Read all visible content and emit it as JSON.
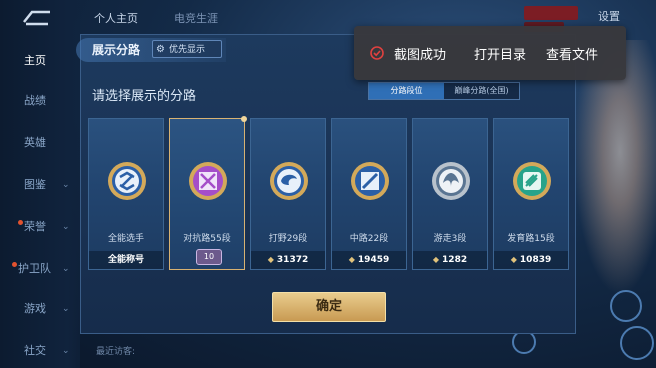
{
  "header": {
    "tab_profile": "个人主页",
    "tab_career": "电竞生涯",
    "settings": "设置"
  },
  "sidebar": {
    "items": [
      {
        "label": "主页",
        "active": true
      },
      {
        "label": "战绩"
      },
      {
        "label": "英雄"
      },
      {
        "label": "图鉴"
      },
      {
        "label": "荣誉"
      },
      {
        "label": "护卫队"
      },
      {
        "label": "游戏"
      },
      {
        "label": "社交"
      }
    ]
  },
  "dialog": {
    "title": "展示分路",
    "priority_button": "优先显示",
    "subtitle": "请选择展示的分路",
    "tabs": [
      "分路段位",
      "巅峰分路(全国)"
    ],
    "active_tab_index": 0,
    "cards": [
      {
        "label": "全能选手",
        "footer": "全能称号",
        "icon": "all-round-emblem-icon",
        "selected": false,
        "has_diamond": false
      },
      {
        "label": "对抗路55段",
        "footer": "",
        "badge": "10",
        "icon": "clash-lane-emblem-icon",
        "selected": true
      },
      {
        "label": "打野29段",
        "footer": "31372",
        "icon": "jungle-emblem-icon",
        "selected": false,
        "has_diamond": true
      },
      {
        "label": "中路22段",
        "footer": "19459",
        "icon": "mid-lane-emblem-icon",
        "selected": false,
        "has_diamond": true
      },
      {
        "label": "游走3段",
        "footer": "1282",
        "icon": "roam-emblem-icon",
        "selected": false,
        "has_diamond": true
      },
      {
        "label": "发育路15段",
        "footer": "10839",
        "icon": "farm-lane-emblem-icon",
        "selected": false,
        "has_diamond": true
      }
    ],
    "confirm": "确定"
  },
  "bottom_hint": "最近访客:",
  "toast": {
    "message": "截图成功",
    "open_folder": "打开目录",
    "view_file": "查看文件"
  },
  "colors": {
    "accent_gold": "#d8b272",
    "active_tab": "#2f6fb6",
    "toast_bg": "#38383c",
    "success_red": "#e0413f"
  }
}
